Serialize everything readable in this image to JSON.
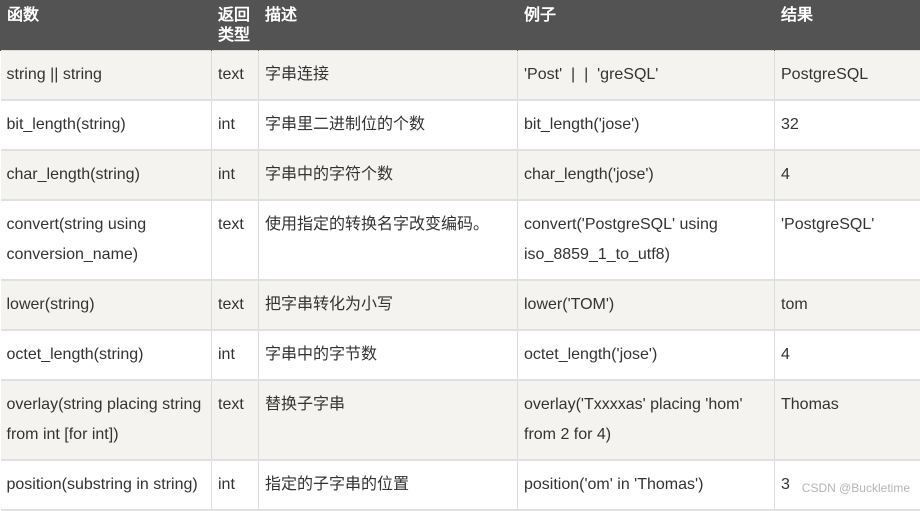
{
  "table": {
    "headers": [
      "函数",
      "返回类型",
      "描述",
      "例子",
      "结果"
    ],
    "rows": [
      {
        "func": "string || string",
        "ret": "text",
        "desc": "字串连接",
        "example": "'Post'  |  |  'greSQL'",
        "result": "PostgreSQL"
      },
      {
        "func": "bit_length(string)",
        "ret": "int",
        "desc": "字串里二进制位的个数",
        "example": "bit_length('jose')",
        "result": "32"
      },
      {
        "func": "char_length(string)",
        "ret": "int",
        "desc": "字串中的字符个数",
        "example": "char_length('jose')",
        "result": "4"
      },
      {
        "func": "convert(string using conversion_name)",
        "ret": "text",
        "desc": "使用指定的转换名字改变编码。",
        "example": "convert('PostgreSQL' using iso_8859_1_to_utf8)",
        "result": "'PostgreSQL'"
      },
      {
        "func": "lower(string)",
        "ret": "text",
        "desc": "把字串转化为小写",
        "example": "lower('TOM')",
        "result": "tom"
      },
      {
        "func": "octet_length(string)",
        "ret": "int",
        "desc": "字串中的字节数",
        "example": "octet_length('jose')",
        "result": "4"
      },
      {
        "func": "overlay(string placing string from int [for int])",
        "ret": "text",
        "desc": "替换子字串",
        "example": "overlay('Txxxxas' placing 'hom' from 2 for 4)",
        "result": "Thomas"
      },
      {
        "func": "position(substring in string)",
        "ret": "int",
        "desc": "指定的子字串的位置",
        "example": "position('om' in 'Thomas')",
        "result": "3"
      }
    ]
  },
  "watermark": "CSDN @Buckletime"
}
